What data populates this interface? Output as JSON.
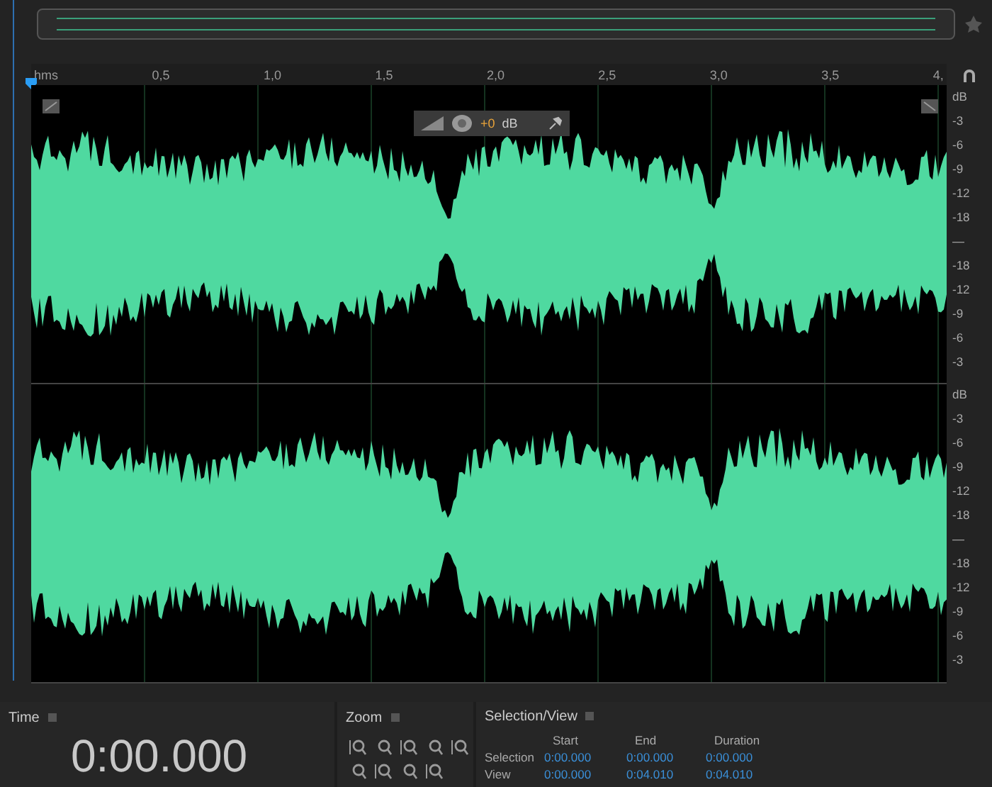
{
  "ruler": {
    "unit": "hms",
    "ticks": [
      "0,5",
      "1,0",
      "1,5",
      "2,0",
      "2,5",
      "3,0",
      "3,5",
      "4,"
    ]
  },
  "hud": {
    "gain": "+0",
    "unit": "dB"
  },
  "channels": [
    {
      "scale": [
        "dB",
        "-3",
        "-6",
        "-9",
        "-12",
        "-18",
        "—",
        "-18",
        "-12",
        "-9",
        "-6",
        "-3"
      ]
    },
    {
      "scale": [
        "dB",
        "-3",
        "-6",
        "-9",
        "-12",
        "-18",
        "—",
        "-18",
        "-12",
        "-9",
        "-6",
        "-3"
      ]
    }
  ],
  "time_panel": {
    "title": "Time",
    "value": "0:00.000"
  },
  "zoom_panel": {
    "title": "Zoom"
  },
  "selection_panel": {
    "title": "Selection/View",
    "columns": [
      "Start",
      "End",
      "Duration"
    ],
    "rows": [
      {
        "label": "Selection",
        "values": [
          "0:00.000",
          "0:00.000",
          "0:00.000"
        ]
      },
      {
        "label": "View",
        "values": [
          "0:00.000",
          "0:04.010",
          "0:04.010"
        ]
      }
    ]
  }
}
